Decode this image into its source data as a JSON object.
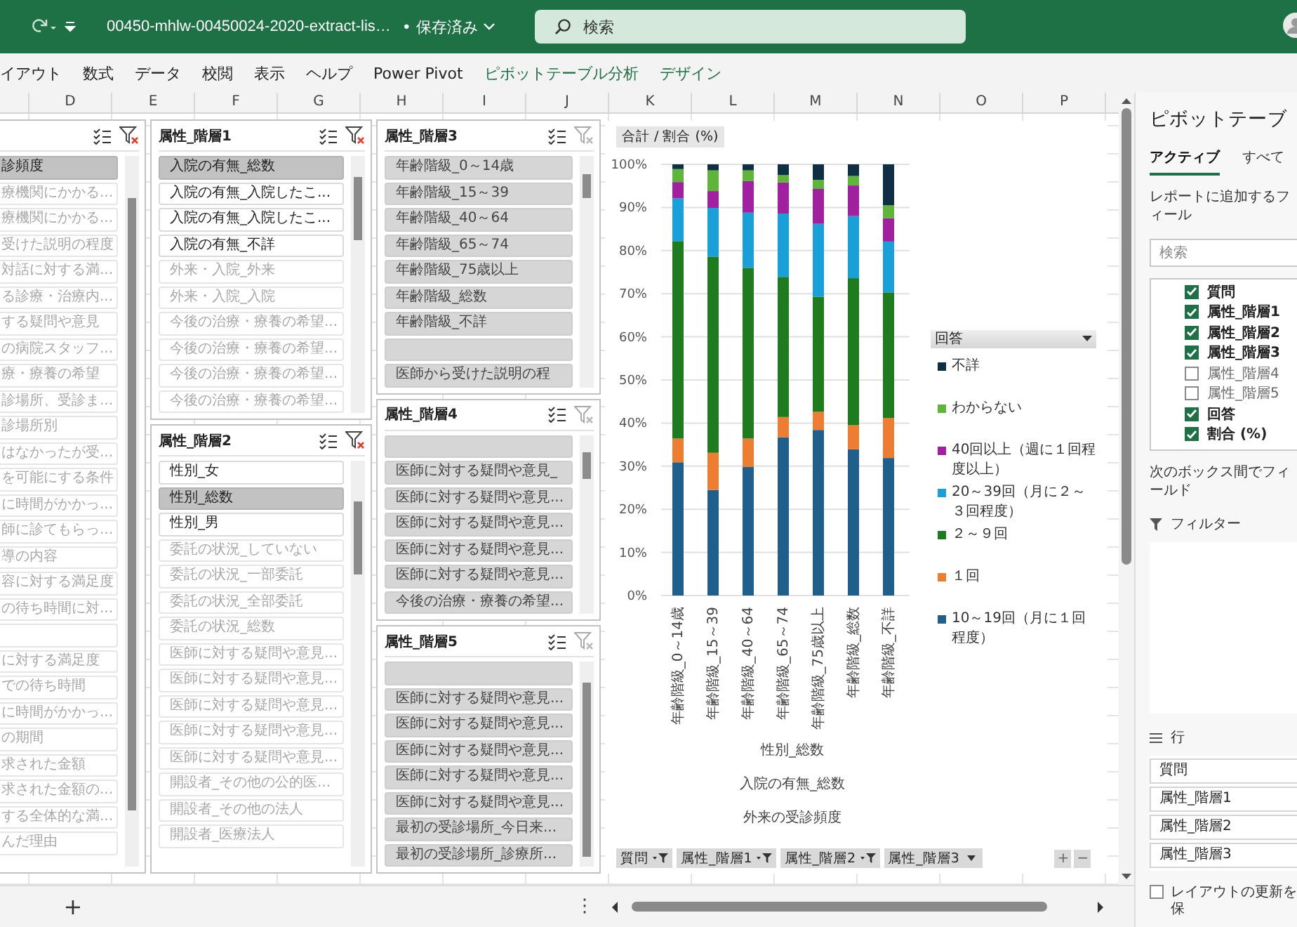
{
  "title_bar": {
    "filename": "00450-mhlw-00450024-2020-extract-lis…",
    "save_status": "• 保存済み",
    "search": {
      "placeholder": "検索"
    }
  },
  "ribbon_tabs": [
    {
      "label": "イアウト",
      "contextual": false
    },
    {
      "label": "数式",
      "contextual": false
    },
    {
      "label": "データ",
      "contextual": false
    },
    {
      "label": "校閲",
      "contextual": false
    },
    {
      "label": "表示",
      "contextual": false
    },
    {
      "label": "ヘルプ",
      "contextual": false
    },
    {
      "label": "Power Pivot",
      "contextual": false
    },
    {
      "label": "ピボットテーブル分析",
      "contextual": true
    },
    {
      "label": "デザイン",
      "contextual": true
    }
  ],
  "column_headers": [
    "D",
    "E",
    "F",
    "G",
    "H",
    "I",
    "J",
    "K",
    "L",
    "M",
    "N",
    "O",
    "P"
  ],
  "slicer_columns": [
    {
      "slicers": [
        {
          "filtered": true,
          "items": [
            {
              "label": "診頻度",
              "selected": true,
              "has_data": true
            },
            {
              "label": "療機関にかかる...",
              "selected": false,
              "has_data": false
            },
            {
              "label": "療機関にかかる...",
              "selected": false,
              "has_data": false
            },
            {
              "label": "受けた説明の程度",
              "selected": false,
              "has_data": false
            },
            {
              "label": "対話に対する満...",
              "selected": false,
              "has_data": false
            },
            {
              "label": "る診療・治療内...",
              "selected": false,
              "has_data": false
            },
            {
              "label": "する疑問や意見",
              "selected": false,
              "has_data": false
            },
            {
              "label": "の病院スタッフ...",
              "selected": false,
              "has_data": false
            },
            {
              "label": "療・療養の希望",
              "selected": false,
              "has_data": false
            },
            {
              "label": "診場所、受診ま...",
              "selected": false,
              "has_data": false
            },
            {
              "label": "診場所別",
              "selected": false,
              "has_data": false
            },
            {
              "label": "はなかったが受...",
              "selected": false,
              "has_data": false
            },
            {
              "label": "を可能にする条件",
              "selected": false,
              "has_data": false
            },
            {
              "label": "に時間がかかっ...",
              "selected": false,
              "has_data": false
            },
            {
              "label": "師に診てもらっ...",
              "selected": false,
              "has_data": false
            },
            {
              "label": "導の内容",
              "selected": false,
              "has_data": false
            },
            {
              "label": "容に対する満足度",
              "selected": false,
              "has_data": false
            },
            {
              "label": "の待ち時間に対...",
              "selected": false,
              "has_data": false
            },
            {
              "selected": false,
              "has_data": false
            },
            {
              "label": "に対する満足度",
              "selected": false,
              "has_data": false
            },
            {
              "label": "での待ち時間",
              "selected": false,
              "has_data": false
            },
            {
              "label": "に時間がかかっ...",
              "selected": false,
              "has_data": false
            },
            {
              "label": "の期間",
              "selected": false,
              "has_data": false
            },
            {
              "label": "求された金額",
              "selected": false,
              "has_data": false
            },
            {
              "label": "求された金額の...",
              "selected": false,
              "has_data": false
            },
            {
              "label": "する全体的な満...",
              "selected": false,
              "has_data": false
            },
            {
              "label": "んだ理由",
              "selected": false,
              "has_data": false
            }
          ]
        }
      ]
    },
    {
      "slicers": [
        {
          "title": "属性_階層1",
          "filtered": true,
          "items": [
            {
              "label": "入院の有無_総数",
              "selected": true,
              "has_data": true
            },
            {
              "label": "入院の有無_入院したこ...",
              "selected": false,
              "has_data": true
            },
            {
              "label": "入院の有無_入院したこ...",
              "selected": false,
              "has_data": true
            },
            {
              "label": "入院の有無_不詳",
              "selected": false,
              "has_data": true
            },
            {
              "label": "外来・入院_外来",
              "selected": false,
              "has_data": false
            },
            {
              "label": "外来・入院_入院",
              "selected": false,
              "has_data": false
            },
            {
              "label": "今後の治療・療養の希望...",
              "selected": false,
              "has_data": false
            },
            {
              "label": "今後の治療・療養の希望...",
              "selected": false,
              "has_data": false
            },
            {
              "label": "今後の治療・療養の希望...",
              "selected": false,
              "has_data": false
            },
            {
              "label": "今後の治療・療養の希望...",
              "selected": false,
              "has_data": false
            }
          ]
        },
        {
          "title": "属性_階層2",
          "filtered": true,
          "items": [
            {
              "label": "性別_女",
              "selected": false,
              "has_data": true
            },
            {
              "label": "性別_総数",
              "selected": true,
              "has_data": true
            },
            {
              "label": "性別_男",
              "selected": false,
              "has_data": true
            },
            {
              "label": "委託の状況_していない",
              "selected": false,
              "has_data": false
            },
            {
              "label": "委託の状況_一部委託",
              "selected": false,
              "has_data": false
            },
            {
              "label": "委託の状況_全部委託",
              "selected": false,
              "has_data": false
            },
            {
              "label": "委託の状況_総数",
              "selected": false,
              "has_data": false
            },
            {
              "label": "医師に対する疑問や意見...",
              "selected": false,
              "has_data": false
            },
            {
              "label": "医師に対する疑問や意見...",
              "selected": false,
              "has_data": false
            },
            {
              "label": "医師に対する疑問や意見...",
              "selected": false,
              "has_data": false
            },
            {
              "label": "医師に対する疑問や意見...",
              "selected": false,
              "has_data": false
            },
            {
              "label": "医師に対する疑問や意見...",
              "selected": false,
              "has_data": false
            },
            {
              "label": "開設者_その他の公的医...",
              "selected": false,
              "has_data": false
            },
            {
              "label": "開設者_その他の法人",
              "selected": false,
              "has_data": false
            },
            {
              "label": "開設者_医療法人",
              "selected": false,
              "has_data": false
            }
          ]
        }
      ]
    },
    {
      "slicers": [
        {
          "title": "属性_階層3",
          "filtered": false,
          "items": [
            {
              "label": "年齢階級_0～14歳",
              "selected": true,
              "has_data": false
            },
            {
              "label": "年齢階級_15～39",
              "selected": true,
              "has_data": false
            },
            {
              "label": "年齢階級_40～64",
              "selected": true,
              "has_data": false
            },
            {
              "label": "年齢階級_65～74",
              "selected": true,
              "has_data": false
            },
            {
              "label": "年齢階級_75歳以上",
              "selected": true,
              "has_data": false
            },
            {
              "label": "年齢階級_総数",
              "selected": true,
              "has_data": false
            },
            {
              "label": "年齢階級_不詳",
              "selected": true,
              "has_data": false
            },
            {
              "selected": true,
              "has_data": false
            },
            {
              "label": "医師から受けた説明の程",
              "selected": true,
              "has_data": false
            }
          ]
        },
        {
          "title": "属性_階層4",
          "filtered": false,
          "items": [
            {
              "selected": true,
              "has_data": false
            },
            {
              "label": "医師に対する疑問や意見_",
              "selected": true,
              "has_data": false
            },
            {
              "label": "医師に対する疑問や意見...",
              "selected": true,
              "has_data": false
            },
            {
              "label": "医師に対する疑問や意見...",
              "selected": true,
              "has_data": false
            },
            {
              "label": "医師に対する疑問や意見...",
              "selected": true,
              "has_data": false
            },
            {
              "label": "医師に対する疑問や意見...",
              "selected": true,
              "has_data": false
            },
            {
              "label": "今後の治療・療養の希望...",
              "selected": true,
              "has_data": false
            }
          ]
        },
        {
          "title": "属性_階層5",
          "filtered": false,
          "items": [
            {
              "selected": true,
              "has_data": false
            },
            {
              "label": "医師に対する疑問や意見...",
              "selected": true,
              "has_data": false
            },
            {
              "label": "医師に対する疑問や意見...",
              "selected": true,
              "has_data": false
            },
            {
              "label": "医師に対する疑問や意見...",
              "selected": true,
              "has_data": false
            },
            {
              "label": "医師に対する疑問や意見...",
              "selected": true,
              "has_data": false
            },
            {
              "label": "医師に対する疑問や意見...",
              "selected": true,
              "has_data": false
            },
            {
              "label": "最初の受診場所_今日来...",
              "selected": true,
              "has_data": false
            },
            {
              "label": "最初の受診場所_診療所...",
              "selected": true,
              "has_data": false
            }
          ]
        }
      ]
    }
  ],
  "chart": {
    "value_field": "合計 / 割合 (%)",
    "legend_title": "回答",
    "chart_data": {
      "type": "bar",
      "stacked": true,
      "orientation": "vertical",
      "grid": true,
      "legend": "right",
      "categories": [
        "年齢階級_0～14歳",
        "年齢階級_15～39",
        "年齢階級_40～64",
        "年齢階級_65～74",
        "年齢階級_75歳以上",
        "年齢階級_総数",
        "年齢階級_不詳"
      ],
      "ylim": [
        0,
        100
      ],
      "yticks": [
        {
          "value": 0,
          "label": "0%"
        },
        {
          "value": 10,
          "label": "10%"
        },
        {
          "value": 20,
          "label": "20%"
        },
        {
          "value": 30,
          "label": "30%"
        },
        {
          "value": 40,
          "label": "40%"
        },
        {
          "value": 50,
          "label": "50%"
        },
        {
          "value": 60,
          "label": "60%"
        },
        {
          "value": 70,
          "label": "70%"
        },
        {
          "value": 80,
          "label": "80%"
        },
        {
          "value": 90,
          "label": "90%"
        },
        {
          "value": 100,
          "label": "100%"
        }
      ],
      "series": [
        {
          "name": "10～19回（月に１回程度）",
          "color": "#1f5f8b",
          "values": [
            30.9,
            24.5,
            29.8,
            36.7,
            38.4,
            33.9,
            31.9
          ]
        },
        {
          "name": "１回",
          "color": "#ed7d31",
          "values": [
            5.5,
            8.6,
            6.6,
            4.7,
            4.2,
            5.6,
            9.3
          ]
        },
        {
          "name": "２～９回",
          "color": "#1e7b1e",
          "values": [
            45.8,
            45.5,
            39.6,
            32.5,
            26.7,
            34.1,
            29.1
          ]
        },
        {
          "name": "20～39回（月に２～３回程度）",
          "color": "#1aa0d8",
          "values": [
            9.9,
            11.3,
            12.8,
            14.7,
            16.9,
            14.4,
            11.8
          ]
        },
        {
          "name": "40回以上（週に１回程度以上）",
          "color": "#a020a0",
          "values": [
            3.8,
            3.9,
            7.3,
            7.2,
            8.1,
            7.1,
            5.4
          ]
        },
        {
          "name": "わからない",
          "color": "#5fb53a",
          "values": [
            3.0,
            4.8,
            2.5,
            1.7,
            2.1,
            2.2,
            3.0
          ]
        },
        {
          "name": "不詳",
          "color": "#0e2f44",
          "values": [
            1.1,
            1.4,
            1.4,
            2.5,
            3.6,
            2.7,
            9.5
          ]
        }
      ]
    },
    "axis_levels": [
      "性別_総数",
      "入院の有無_総数",
      "外来の受診頻度"
    ],
    "field_buttons": [
      {
        "label": "質問",
        "kind": "filter"
      },
      {
        "label": "属性_階層1",
        "kind": "filter"
      },
      {
        "label": "属性_階層2",
        "kind": "filter"
      },
      {
        "label": "属性_階層3",
        "kind": "dropdown"
      }
    ],
    "zoom_buttons": [
      "+",
      "−"
    ]
  },
  "pivot_pane": {
    "title": "ピボットテーブ",
    "tabs": [
      {
        "label": "アクティブ",
        "selected": true
      },
      {
        "label": "すべて",
        "selected": false
      }
    ],
    "fields_hint": "レポートに追加するフィール",
    "search": {
      "placeholder": "検索"
    },
    "fields": [
      {
        "label": "質問",
        "checked": true
      },
      {
        "label": "属性_階層1",
        "checked": true
      },
      {
        "label": "属性_階層2",
        "checked": true
      },
      {
        "label": "属性_階層3",
        "checked": true
      },
      {
        "label": "属性_階層4",
        "checked": false
      },
      {
        "label": "属性_階層5",
        "checked": false
      },
      {
        "label": "回答",
        "checked": true
      },
      {
        "label": "割合 (%)",
        "checked": true
      }
    ],
    "areas_hint": "次のボックス間でフィールド",
    "filters_label": "フィルター",
    "rows_label": "行",
    "rows": [
      "質問",
      "属性_階層1",
      "属性_階層2",
      "属性_階層3"
    ],
    "defer_update": {
      "label": "レイアウトの更新を保",
      "checked": false
    }
  },
  "bottom_bar": {
    "add_sheet": "+",
    "more": "⋮"
  }
}
